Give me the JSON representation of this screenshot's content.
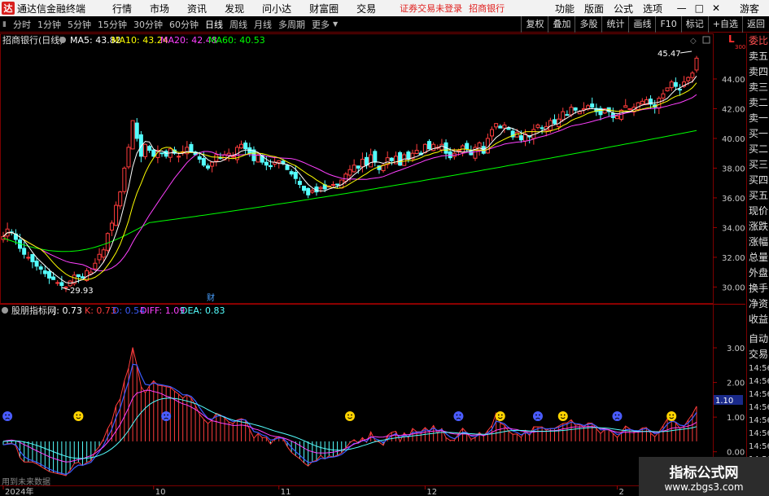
{
  "titlebar": {
    "app_title": "通达信金融终端",
    "menu": [
      "行情",
      "市场",
      "资讯",
      "发现",
      "问小达",
      "财富圈",
      "交易"
    ],
    "warning": "证券交易未登录",
    "bank": "招商银行",
    "right_menu": [
      "功能",
      "版面",
      "公式",
      "选项"
    ],
    "guest": "游客"
  },
  "toolbar": {
    "periods": [
      "分时",
      "1分钟",
      "5分钟",
      "15分钟",
      "30分钟",
      "60分钟",
      "日线",
      "周线",
      "月线",
      "多周期",
      "更多"
    ],
    "active_period": "日线",
    "buttons": [
      "复权",
      "叠加",
      "多股",
      "统计",
      "画线",
      "F10",
      "标记",
      "+自选",
      "返回"
    ]
  },
  "main_legend": {
    "name": "招商银行(日线)",
    "ma5": "MA5: 43.82",
    "ma10": "MA10: 43.24",
    "ma20": "MA20: 42.48",
    "ma60": "MA60: 40.53"
  },
  "sub_legend": {
    "name": "股朋指标网",
    "j": "J: 0.73",
    "k": "K: 0.73",
    "d": "D: 0.54",
    "diff": "DIFF: 1.09",
    "dea": "DEA: 0.83"
  },
  "annotations": {
    "high": "45.47",
    "low": "29.93",
    "cai": "财",
    "sub_value": "1.10",
    "hint": "用到未来数据"
  },
  "colors": {
    "up": "#ff3c3c",
    "down": "#54ffff",
    "ma5": "#ffffff",
    "ma10": "#ffff00",
    "ma20": "#ff40ff",
    "ma60": "#00ff00"
  },
  "chart_data": [
    {
      "type": "candlestick",
      "ylim": [
        29.2,
        46.3
      ],
      "y_ticks": [
        "30.00",
        "32.00",
        "34.00",
        "36.00",
        "38.00",
        "40.00",
        "42.00",
        "44.00"
      ],
      "corner_mark": "L",
      "corner_num": "300",
      "close": [
        33.4,
        33.9,
        33.7,
        33.2,
        32.6,
        32.2,
        32.0,
        31.7,
        31.4,
        31.2,
        30.9,
        30.6,
        30.5,
        30.3,
        30.1,
        30.0,
        30.4,
        30.8,
        30.7,
        30.6,
        31.1,
        31.0,
        31.6,
        32.2,
        32.5,
        33.6,
        34.3,
        35.5,
        36.4,
        38.0,
        39.4,
        41.2,
        40.0,
        38.8,
        39.6,
        39.2,
        38.8,
        39.2,
        39.0,
        38.8,
        39.3,
        39.0,
        38.8,
        39.1,
        39.4,
        39.1,
        38.9,
        38.6,
        38.2,
        38.0,
        38.4,
        38.9,
        38.7,
        38.9,
        39.0,
        38.8,
        39.4,
        39.6,
        39.3,
        39.0,
        38.5,
        38.9,
        38.4,
        38.2,
        38.1,
        38.4,
        38.5,
        38.3,
        37.9,
        37.6,
        37.3,
        36.9,
        36.5,
        36.2,
        36.5,
        36.4,
        36.7,
        36.6,
        36.8,
        36.9,
        36.9,
        37.2,
        37.6,
        37.9,
        38.2,
        38.0,
        38.6,
        38.2,
        38.9,
        38.4,
        37.9,
        38.2,
        38.7,
        38.5,
        38.8,
        38.2,
        38.9,
        38.6,
        39.0,
        39.2,
        38.9,
        39.6,
        39.3,
        39.6,
        39.4,
        39.6,
        39.0,
        38.7,
        39.0,
        39.2,
        39.5,
        39.3,
        38.9,
        39.4,
        39.7,
        39.0,
        40.0,
        40.6,
        41.0,
        40.7,
        40.9,
        40.6,
        40.1,
        40.4,
        39.9,
        40.3,
        40.1,
        40.6,
        40.9,
        40.7,
        40.8,
        41.2,
        41.0,
        41.3,
        41.8,
        41.6,
        42.1,
        41.9,
        41.8,
        42.0,
        42.2,
        42.1,
        41.8,
        41.6,
        42.0,
        41.8,
        41.4,
        41.5,
        41.9,
        42.2,
        42.0,
        42.1,
        42.4,
        42.5,
        42.6,
        42.3,
        42.1,
        42.7,
        43.0,
        43.4,
        43.8,
        43.5,
        43.3,
        43.8,
        44.1,
        44.4,
        45.4
      ],
      "ma60_start": 33.3,
      "ma60_end": 40.53
    },
    {
      "type": "indicator",
      "ylim": [
        -0.9,
        3.8
      ],
      "y_ticks": [
        "3.00",
        "2.00",
        "1.00",
        "0.00"
      ],
      "x_ticks": [
        "2024年",
        "10",
        "11",
        "12",
        "2"
      ]
    }
  ]
}
